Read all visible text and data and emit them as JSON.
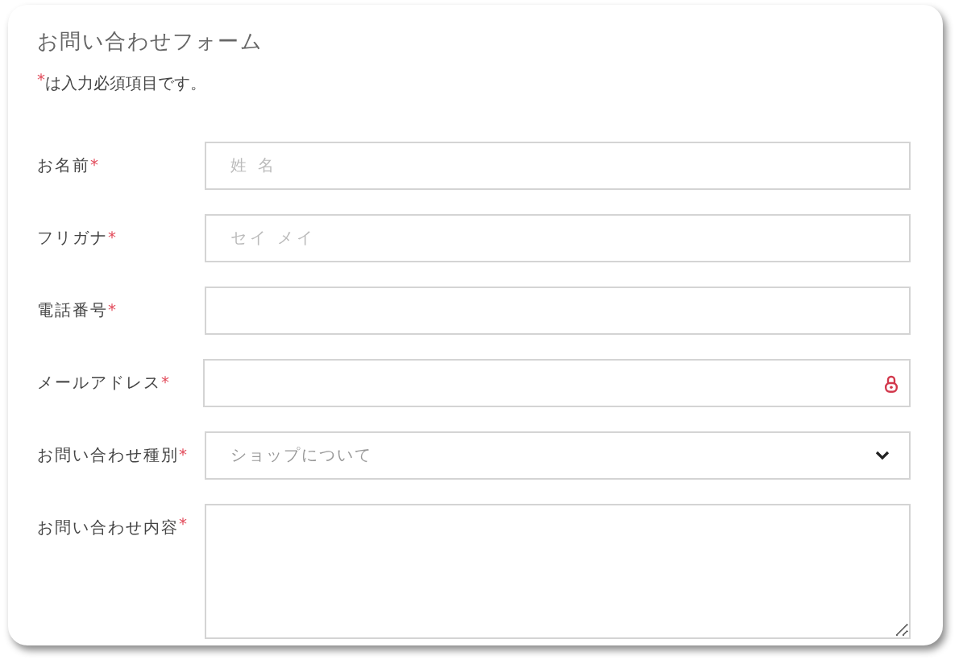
{
  "form": {
    "title": "お問い合わせフォーム",
    "note": {
      "mark": "*",
      "text": "は入力必須項目です。"
    },
    "fields": [
      {
        "label": "お名前",
        "mark": "*",
        "kind": "text",
        "placeholder": "姓 名"
      },
      {
        "label": "フリガナ",
        "mark": "*",
        "kind": "text",
        "placeholder": "セイ メイ"
      },
      {
        "label": "電話番号",
        "mark": "*",
        "kind": "text"
      },
      {
        "label": "メールアドレス",
        "mark": "*",
        "kind": "email"
      },
      {
        "label": "お問い合わせ種別",
        "mark": "*",
        "kind": "select",
        "value": "ショップについて"
      },
      {
        "label": "お問い合わせ内容",
        "mark": "*",
        "kind": "textarea"
      }
    ]
  }
}
